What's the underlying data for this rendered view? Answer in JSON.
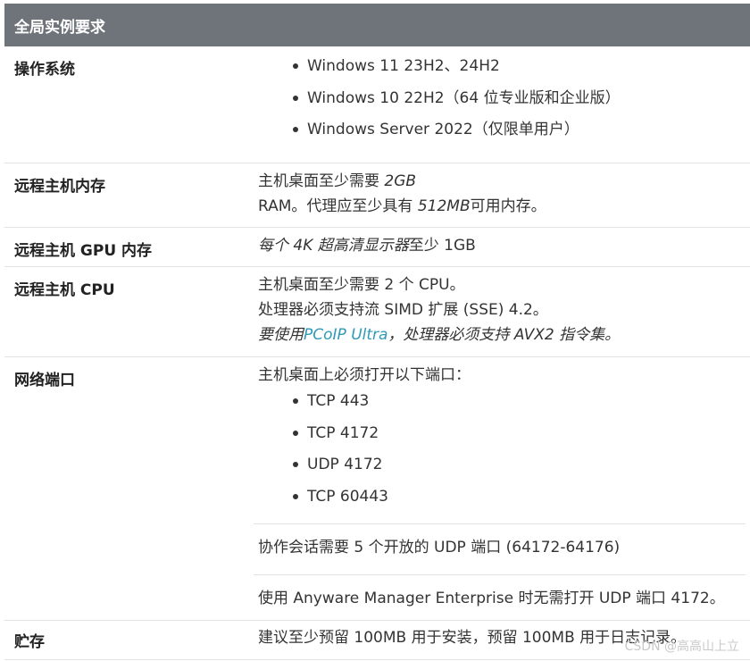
{
  "header": {
    "title": "全局实例要求"
  },
  "rows": {
    "os": {
      "label": "操作系统",
      "items": [
        "Windows 11 23H2、24H2",
        "Windows 10 22H2（64 位专业版和企业版）",
        "Windows Server 2022（仅限单用户）"
      ]
    },
    "memory": {
      "label": "远程主机内存",
      "line1_pre": "主机桌面至少需要 ",
      "line1_it": "2GB",
      "line2_pre": "RAM。代理应至少具有 ",
      "line2_it": "512MB",
      "line2_post": "可用内存。"
    },
    "gpu": {
      "label": "远程主机 GPU 内存",
      "text_it": "每个 4K 超高清显示器",
      "text_post": "至少 1GB"
    },
    "cpu": {
      "label": "远程主机 CPU",
      "line1": "主机桌面至少需要 2 个 CPU。",
      "line2": "处理器必须支持流 SIMD 扩展 (SSE) 4.2。",
      "line3_pre": "要使用",
      "line3_link": "PCoIP Ultra",
      "line3_post": "，处理器必须支持 AVX2 指令集。"
    },
    "network": {
      "label": "网络端口",
      "intro": "主机桌面上必须打开以下端口：",
      "ports": [
        "TCP 443",
        "TCP 4172",
        "UDP 4172",
        "TCP 60443"
      ],
      "collab": "协作会话需要 5 个开放的 UDP 端口 (64172-64176)",
      "awm": "使用 Anyware Manager Enterprise 时无需打开 UDP 端口 4172。"
    },
    "storage": {
      "label": "贮存",
      "text": "建议至少预留 100MB 用于安装，预留 100MB 用于日志记录。"
    }
  },
  "watermark": "CSDN @高高山上立"
}
